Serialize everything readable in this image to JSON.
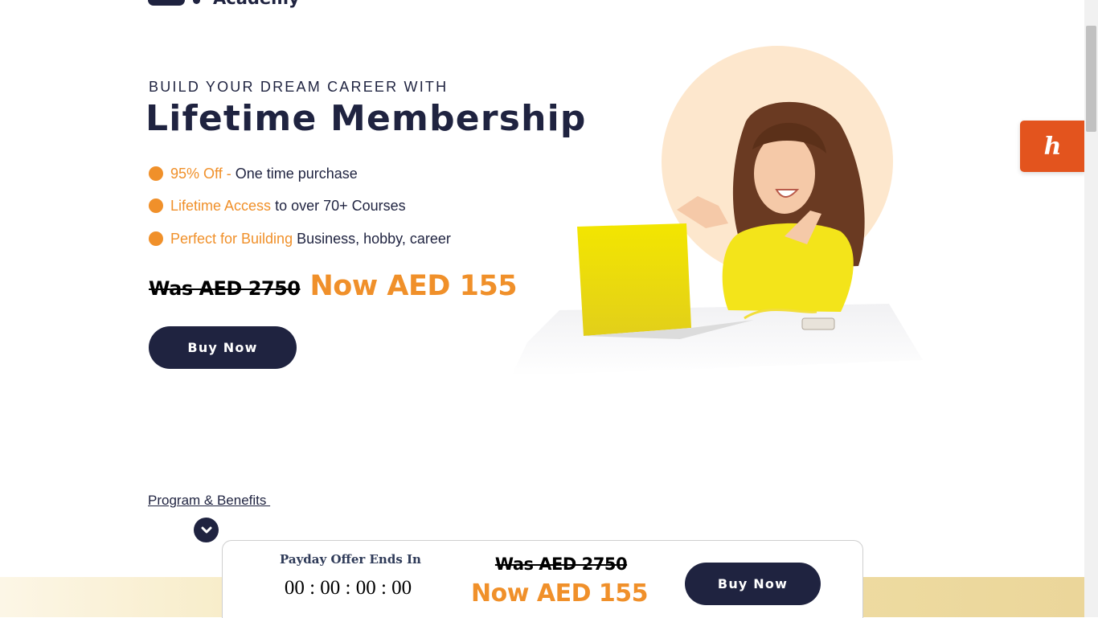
{
  "brand": {
    "name": "Academy",
    "logo_icon": "academy-logo-mark"
  },
  "hero": {
    "eyebrow": "BUILD YOUR DREAM CAREER WITH",
    "headline": "Lifetime Membership",
    "features": [
      {
        "highlight": "95% Off - ",
        "rest": "One time purchase"
      },
      {
        "highlight": "Lifetime Access",
        "rest": " to over 70+ Courses"
      },
      {
        "highlight": "Perfect for Building",
        "rest": " Business, hobby, career"
      }
    ],
    "price_was": "Was AED 2750",
    "price_now": "Now AED 155",
    "buy_label": "Buy Now",
    "image": "woman-laughing-with-yellow-laptop"
  },
  "honey": {
    "label": "h",
    "icon": "honey-extension-icon"
  },
  "program": {
    "link_label": "Program & Benefits ",
    "chevron_icon": "chevron-down-icon"
  },
  "offer_bar": {
    "label": "Payday Offer Ends In",
    "countdown": "00 : 00 : 00 : 00",
    "price_was": "Was AED 2750",
    "price_now": "Now AED 155",
    "buy_label": "Buy Now"
  },
  "colors": {
    "accent": "#f0902a",
    "navy": "#1f2340",
    "honey": "#e3541e",
    "peach": "#fde7cd"
  }
}
